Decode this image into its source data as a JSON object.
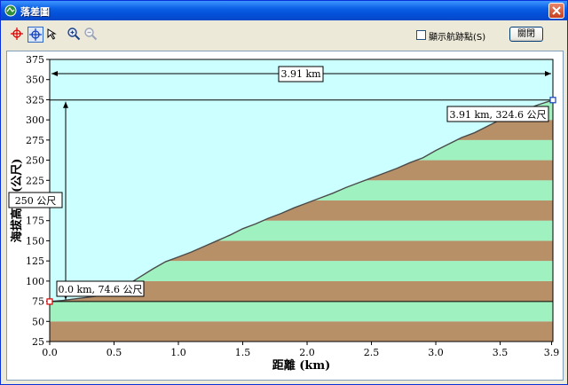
{
  "window": {
    "title": "落差圖"
  },
  "toolbar": {
    "show_waypoints_label": "顯示航跡點(S)",
    "close_label": "關閉",
    "show_waypoints_checked": false
  },
  "chart_data": {
    "type": "area",
    "xlabel": "距離  (km)",
    "ylabel": "海拔高度 (公尺)",
    "xlim": [
      0,
      3.91
    ],
    "ylim": [
      25,
      375
    ],
    "x_ticks": [
      "0.0",
      "0.5",
      "1.0",
      "1.5",
      "2.0",
      "2.5",
      "3.0",
      "3.5",
      "3.9"
    ],
    "x_tick_values": [
      0,
      0.5,
      1.0,
      1.5,
      2.0,
      2.5,
      3.0,
      3.5,
      3.9
    ],
    "y_ticks": [
      25,
      50,
      75,
      100,
      125,
      150,
      175,
      200,
      225,
      250,
      275,
      300,
      325,
      350,
      375
    ],
    "band_step": 25,
    "band_colors": [
      "#b89068",
      "#9ff2c0"
    ],
    "sky_color": "#ccffff",
    "profile": {
      "x": [
        0,
        0.1,
        0.2,
        0.3,
        0.4,
        0.5,
        0.55,
        0.6,
        0.7,
        0.8,
        0.9,
        1.0,
        1.1,
        1.2,
        1.3,
        1.4,
        1.5,
        1.6,
        1.7,
        1.8,
        1.9,
        2.0,
        2.1,
        2.2,
        2.3,
        2.4,
        2.5,
        2.6,
        2.7,
        2.8,
        2.9,
        3.0,
        3.1,
        3.2,
        3.3,
        3.4,
        3.5,
        3.6,
        3.7,
        3.8,
        3.91
      ],
      "y": [
        74.6,
        76,
        78,
        80,
        82,
        84,
        87,
        95,
        105,
        115,
        124,
        130,
        136,
        143,
        150,
        157,
        165,
        171,
        178,
        184,
        191,
        197,
        203,
        209,
        216,
        222,
        228,
        234,
        240,
        247,
        253,
        262,
        270,
        278,
        284,
        292,
        300,
        307,
        313,
        319,
        324.6
      ]
    },
    "annotations": {
      "total_distance": "3.91 km",
      "elevation_gain": "250 公尺",
      "start_label": "0.0 km, 74.6 公尺",
      "end_label": "3.91 km, 324.6 公尺"
    }
  }
}
